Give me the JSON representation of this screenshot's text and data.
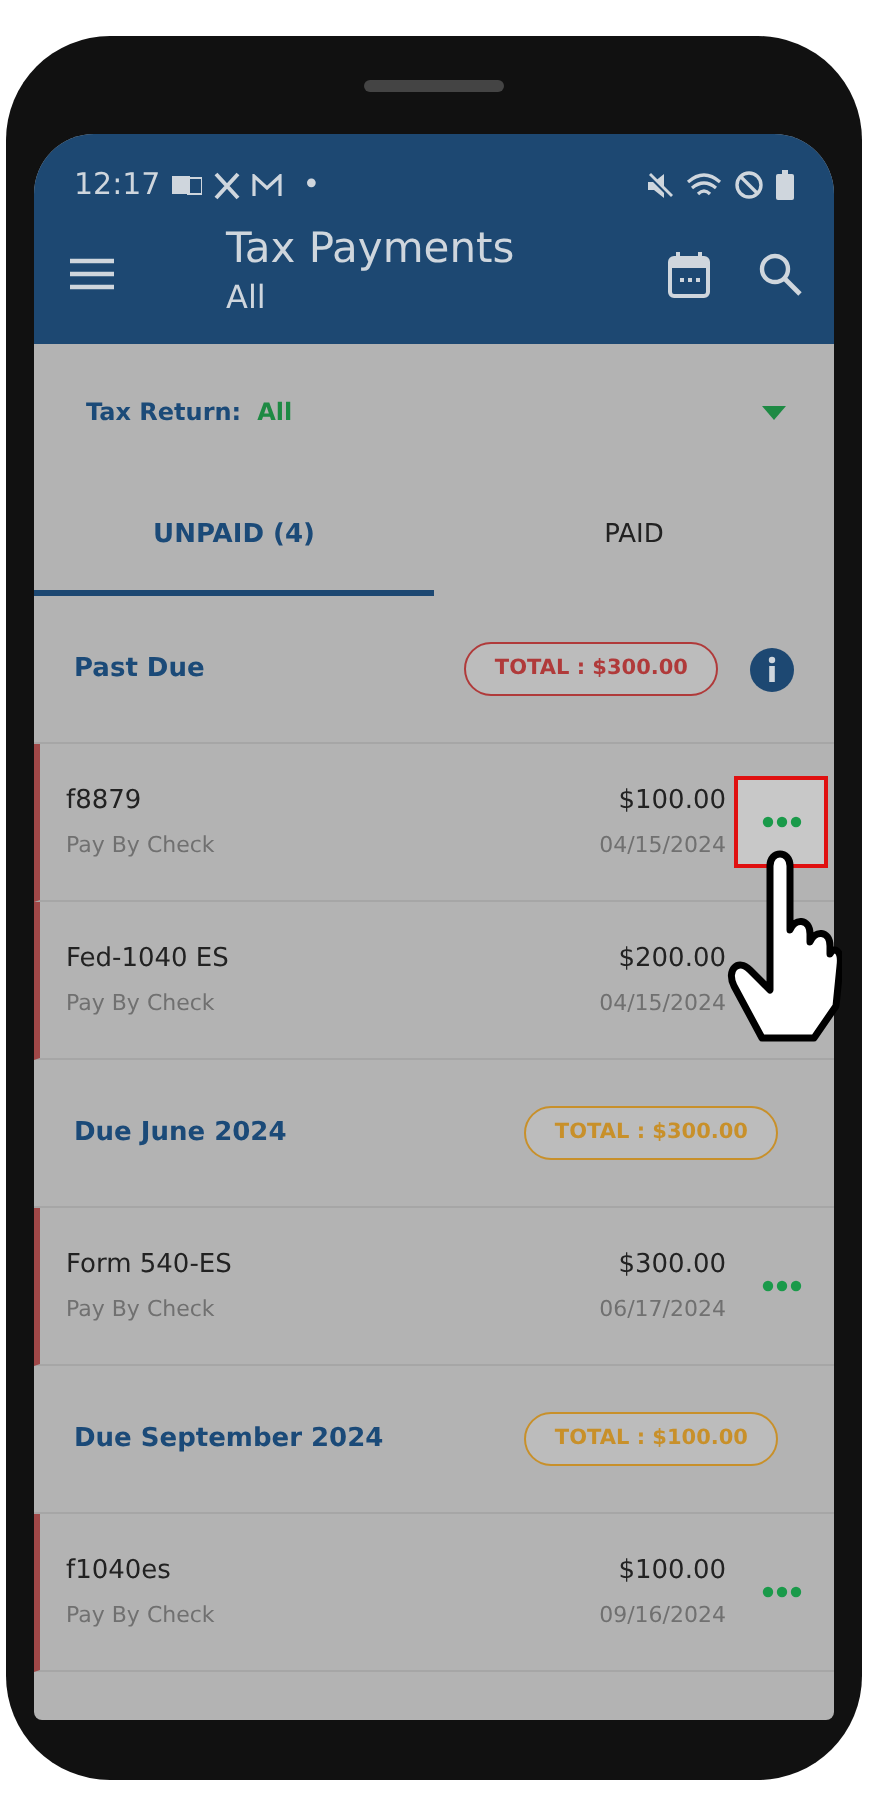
{
  "status_bar": {
    "time": "12:17",
    "dot": "•"
  },
  "app_bar": {
    "title": "Tax Payments",
    "subtitle": "All"
  },
  "filter": {
    "label": "Tax Return:",
    "value": "All"
  },
  "tabs": [
    {
      "label": "UNPAID (4)",
      "selected": true
    },
    {
      "label": "PAID",
      "selected": false
    }
  ],
  "sections": [
    {
      "title": "Past Due",
      "total": "TOTAL : $300.00",
      "color": "#b03a3a",
      "info_button": true,
      "items": [
        {
          "name": "f8879",
          "amount": "$100.00",
          "method": "Pay By Check",
          "date": "04/15/2024",
          "highlighted": true,
          "menu_button": true
        },
        {
          "name": "Fed-1040 ES",
          "amount": "$200.00",
          "method": "Pay By Check",
          "date": "04/15/2024",
          "highlighted": false,
          "menu_button": false
        }
      ]
    },
    {
      "title": "Due June 2024",
      "total": "TOTAL : $300.00",
      "color": "#c8902a",
      "info_button": false,
      "items": [
        {
          "name": "Form 540-ES",
          "amount": "$300.00",
          "method": "Pay By Check",
          "date": "06/17/2024",
          "highlighted": false,
          "menu_button": true
        }
      ]
    },
    {
      "title": "Due September 2024",
      "total": "TOTAL : $100.00",
      "color": "#c8902a",
      "info_button": false,
      "items": [
        {
          "name": "f1040es",
          "amount": "$100.00",
          "method": "Pay By Check",
          "date": "09/16/2024",
          "highlighted": false,
          "menu_button": true
        }
      ]
    }
  ]
}
